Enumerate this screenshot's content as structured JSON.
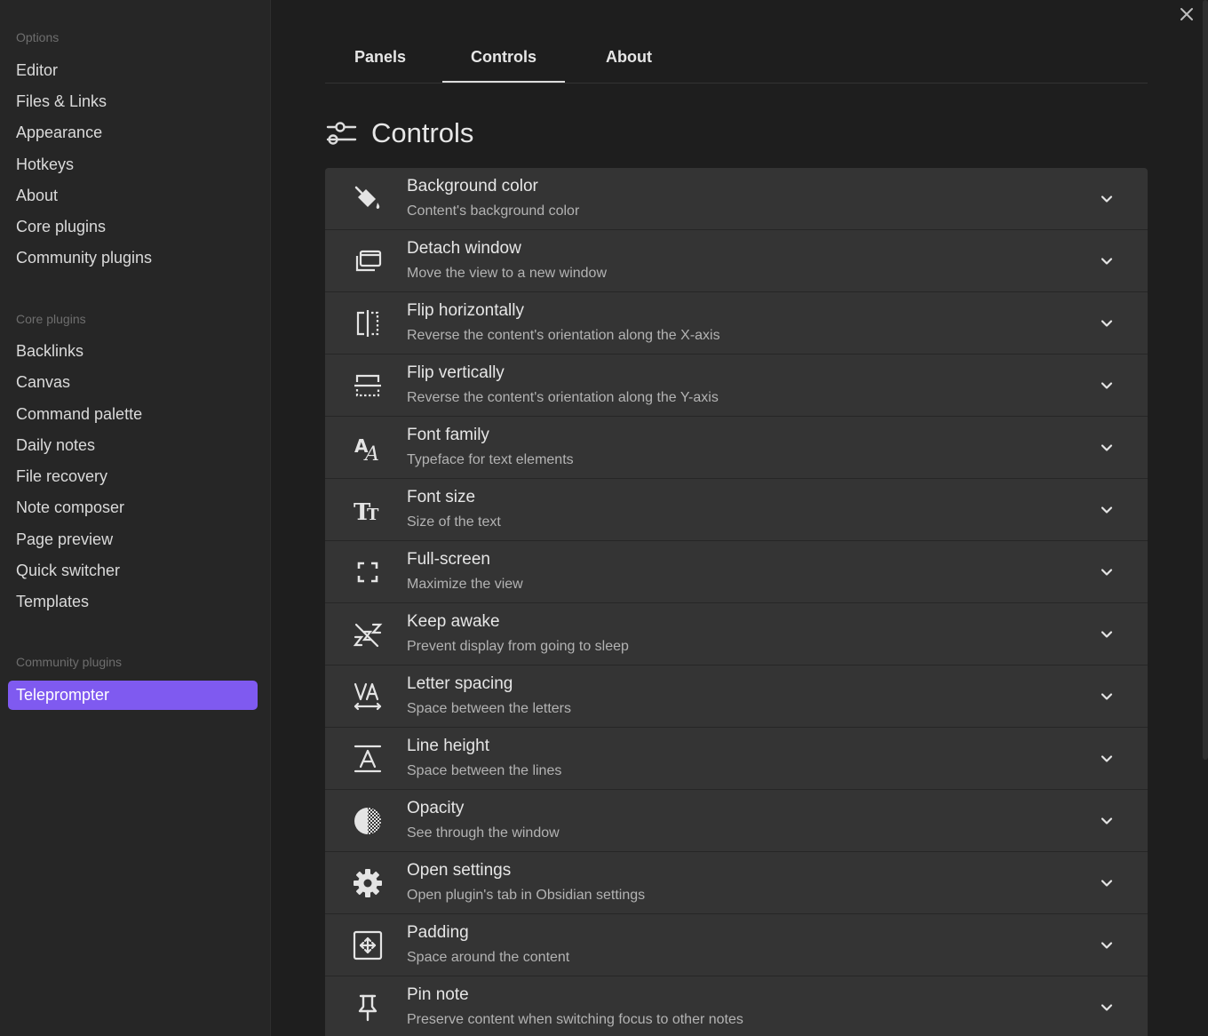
{
  "sidebar": {
    "sections": [
      {
        "title": "Options",
        "items": [
          "Editor",
          "Files & Links",
          "Appearance",
          "Hotkeys",
          "About",
          "Core plugins",
          "Community plugins"
        ]
      },
      {
        "title": "Core plugins",
        "items": [
          "Backlinks",
          "Canvas",
          "Command palette",
          "Daily notes",
          "File recovery",
          "Note composer",
          "Page preview",
          "Quick switcher",
          "Templates"
        ]
      },
      {
        "title": "Community plugins",
        "items": [
          "Teleprompter"
        ]
      }
    ],
    "active_item": "Teleprompter"
  },
  "window": {
    "close_icon": "close-icon"
  },
  "tabs": [
    {
      "label": "Panels"
    },
    {
      "label": "Controls",
      "active": true
    },
    {
      "label": "About"
    }
  ],
  "section": {
    "title": "Controls",
    "icon": "sliders-icon"
  },
  "controls": [
    {
      "name": "Background color",
      "desc": "Content's background color",
      "icon": "paint-bucket-icon"
    },
    {
      "name": "Detach window",
      "desc": "Move the view to a new window",
      "icon": "detach-window-icon"
    },
    {
      "name": "Flip horizontally",
      "desc": "Reverse the content's orientation along the X-axis",
      "icon": "flip-horizontal-icon"
    },
    {
      "name": "Flip vertically",
      "desc": "Reverse the content's orientation along the Y-axis",
      "icon": "flip-vertical-icon"
    },
    {
      "name": "Font family",
      "desc": "Typeface for text elements",
      "icon": "font-family-icon"
    },
    {
      "name": "Font size",
      "desc": "Size of the text",
      "icon": "font-size-icon"
    },
    {
      "name": "Full-screen",
      "desc": "Maximize the view",
      "icon": "fullscreen-icon"
    },
    {
      "name": "Keep awake",
      "desc": "Prevent display from going to sleep",
      "icon": "keep-awake-icon"
    },
    {
      "name": "Letter spacing",
      "desc": "Space between the letters",
      "icon": "letter-spacing-icon"
    },
    {
      "name": "Line height",
      "desc": "Space between the lines",
      "icon": "line-height-icon"
    },
    {
      "name": "Opacity",
      "desc": "See through the window",
      "icon": "opacity-icon"
    },
    {
      "name": "Open settings",
      "desc": "Open plugin's tab in Obsidian settings",
      "icon": "gear-icon"
    },
    {
      "name": "Padding",
      "desc": "Space around the content",
      "icon": "padding-icon"
    },
    {
      "name": "Pin note",
      "desc": "Preserve content when switching focus to other notes",
      "icon": "pin-icon"
    }
  ]
}
